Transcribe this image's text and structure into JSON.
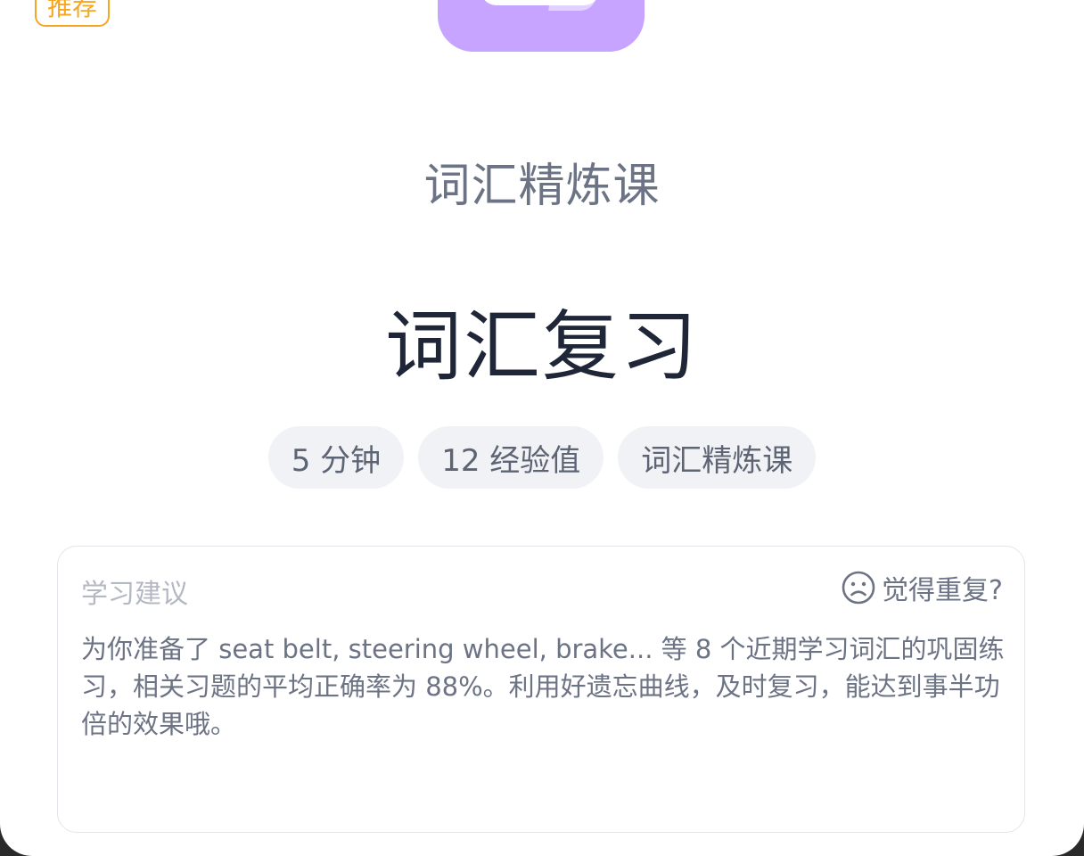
{
  "card": {
    "badge": "推荐",
    "category": "词汇精炼课",
    "title": "词汇复习",
    "tags": [
      {
        "label": "5 分钟"
      },
      {
        "label": "12 经验值"
      },
      {
        "label": "词汇精炼课"
      }
    ]
  },
  "advice": {
    "title": "学习建议",
    "repeat_label": "觉得重复?",
    "repeat_icon": "sad-face-icon",
    "body": "为你准备了 seat belt, steering wheel, brake... 等 8 个近期学习词汇的巩固练习，相关习题的平均正确率为 88%。利用好遗忘曲线，及时复习，能达到事半功倍的效果哦。"
  },
  "colors": {
    "badge": "#f5a623",
    "icon": "#c6a4ff",
    "title": "#1f2637",
    "muted": "#6b7384"
  }
}
